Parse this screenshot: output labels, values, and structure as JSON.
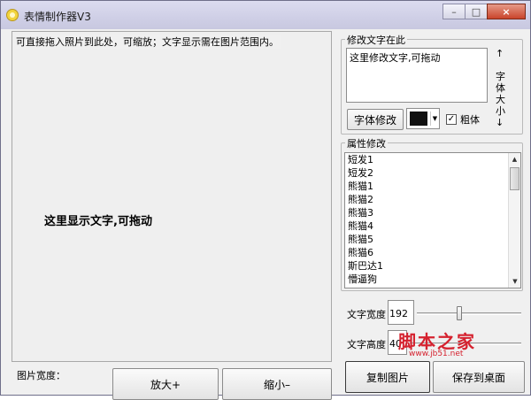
{
  "window": {
    "title": "表情制作器V3",
    "icon": "smiley-icon"
  },
  "caption": {
    "minimize": "–",
    "maximize": "□",
    "close": "×"
  },
  "left_panel": {
    "hint": "可直接拖入照片到此处，可缩放；文字显示需在图片范围内。",
    "canvas_text": "这里显示文字,可拖动"
  },
  "bottom_bar": {
    "image_width_label": "图片宽度：",
    "zoom_in_label": "放大+",
    "zoom_out_label": "缩小–"
  },
  "edit_group": {
    "title": "修改文字在此",
    "text_value": "这里修改文字,可拖动",
    "font_size_up": "↑",
    "font_size_label": "字体大小",
    "font_size_down": "↓",
    "font_button_label": "字体修改",
    "color_value": "#111111",
    "bold_label": "粗体",
    "bold_checked": "✓"
  },
  "attr_group": {
    "title": "属性修改",
    "items": [
      "短发1",
      "短发2",
      "熊猫1",
      "熊猫2",
      "熊猫3",
      "熊猫4",
      "熊猫5",
      "熊猫6",
      "斯巴达1",
      "懵逼狗"
    ]
  },
  "text_size": {
    "width_label": "文字宽度",
    "width_value": "192",
    "height_label": "文字高度",
    "height_value": "40"
  },
  "actions": {
    "copy_label": "复制图片",
    "save_label": "保存到桌面"
  },
  "watermark": {
    "main": "脚本之家",
    "sub": "www.jb51.net"
  }
}
